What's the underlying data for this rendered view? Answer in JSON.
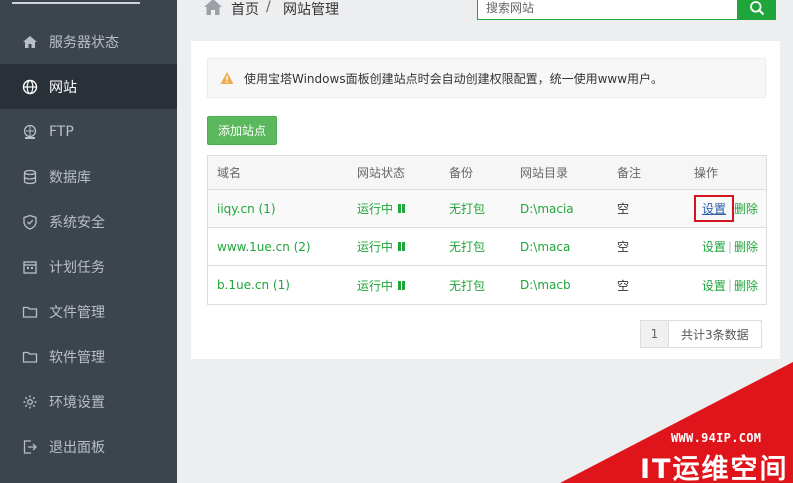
{
  "sidebar": {
    "items": [
      {
        "label": "服务器状态",
        "icon": "home-icon"
      },
      {
        "label": "网站",
        "icon": "globe-icon",
        "active": true
      },
      {
        "label": "FTP",
        "icon": "ftp-icon"
      },
      {
        "label": "数据库",
        "icon": "database-icon"
      },
      {
        "label": "系统安全",
        "icon": "shield-icon"
      },
      {
        "label": "计划任务",
        "icon": "calendar-icon"
      },
      {
        "label": "文件管理",
        "icon": "folder-icon"
      },
      {
        "label": "软件管理",
        "icon": "folder-icon"
      },
      {
        "label": "环境设置",
        "icon": "gear-icon"
      },
      {
        "label": "退出面板",
        "icon": "logout-icon"
      }
    ]
  },
  "header": {
    "breadcrumb_home": "首页",
    "breadcrumb_sep": "/",
    "breadcrumb_current": "网站管理",
    "search_placeholder": "搜索网站"
  },
  "notice": {
    "text": "使用宝塔Windows面板创建站点时会自动创建权限配置，统一使用www用户。"
  },
  "add_site_label": "添加站点",
  "table": {
    "columns": [
      "域名",
      "网站状态",
      "备份",
      "网站目录",
      "备注",
      "操作"
    ],
    "rows": [
      {
        "domain": "iiqy.cn (1)",
        "status": "运行中",
        "backup": "无打包",
        "dir": "D:\\macia",
        "note": "空",
        "set": "设置",
        "del": "删除"
      },
      {
        "domain": "www.1ue.cn (2)",
        "status": "运行中",
        "backup": "无打包",
        "dir": "D:\\maca",
        "note": "空",
        "set": "设置",
        "del": "删除"
      },
      {
        "domain": "b.1ue.cn (1)",
        "status": "运行中",
        "backup": "无打包",
        "dir": "D:\\macb",
        "note": "空",
        "set": "设置",
        "del": "删除"
      }
    ],
    "op_separator": "|"
  },
  "pager": {
    "page": "1",
    "total": "共计3条数据"
  },
  "watermark": {
    "url": "WWW.94IP.COM",
    "brand": "IT运维空间"
  },
  "colors": {
    "sidebar_bg": "#3c444d",
    "accent_green": "#20a53a",
    "highlight_red": "#d0161c"
  }
}
